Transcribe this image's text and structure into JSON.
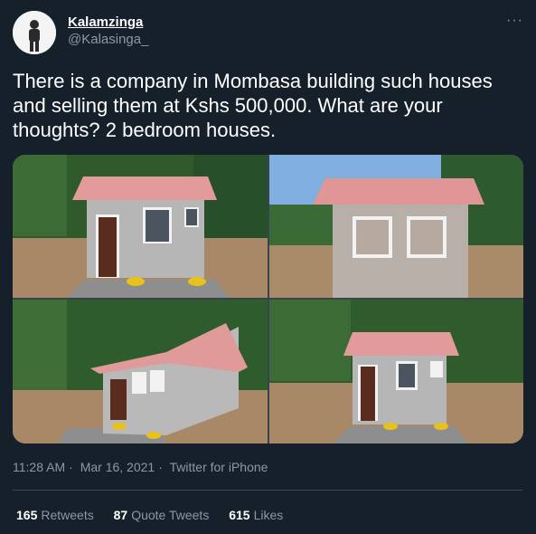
{
  "user": {
    "display_name": "Kalamzinga",
    "handle": "@Kalasinga_",
    "avatar_icon": "person-photo"
  },
  "more_icon": "more-horizontal-icon",
  "tweet": {
    "text": "There is a company in Mombasa building such houses and selling them at Kshs 500,000. What are your thoughts? 2 bedroom houses."
  },
  "media": {
    "count": 4,
    "alt": [
      "house-front-view",
      "house-close-front",
      "house-side-view",
      "house-distant-front"
    ]
  },
  "meta": {
    "time": "11:28 AM",
    "date": "Mar 16, 2021",
    "separator": "·",
    "source": "Twitter for iPhone"
  },
  "stats": {
    "retweets_count": "165",
    "retweets_label": "Retweets",
    "quotes_count": "87",
    "quotes_label": "Quote Tweets",
    "likes_count": "615",
    "likes_label": "Likes"
  },
  "colors": {
    "background": "#15202b",
    "secondary_text": "#8b98a5",
    "divider": "#38444d",
    "roof": "#e8a0a0",
    "wall": "#b8b8b8"
  }
}
